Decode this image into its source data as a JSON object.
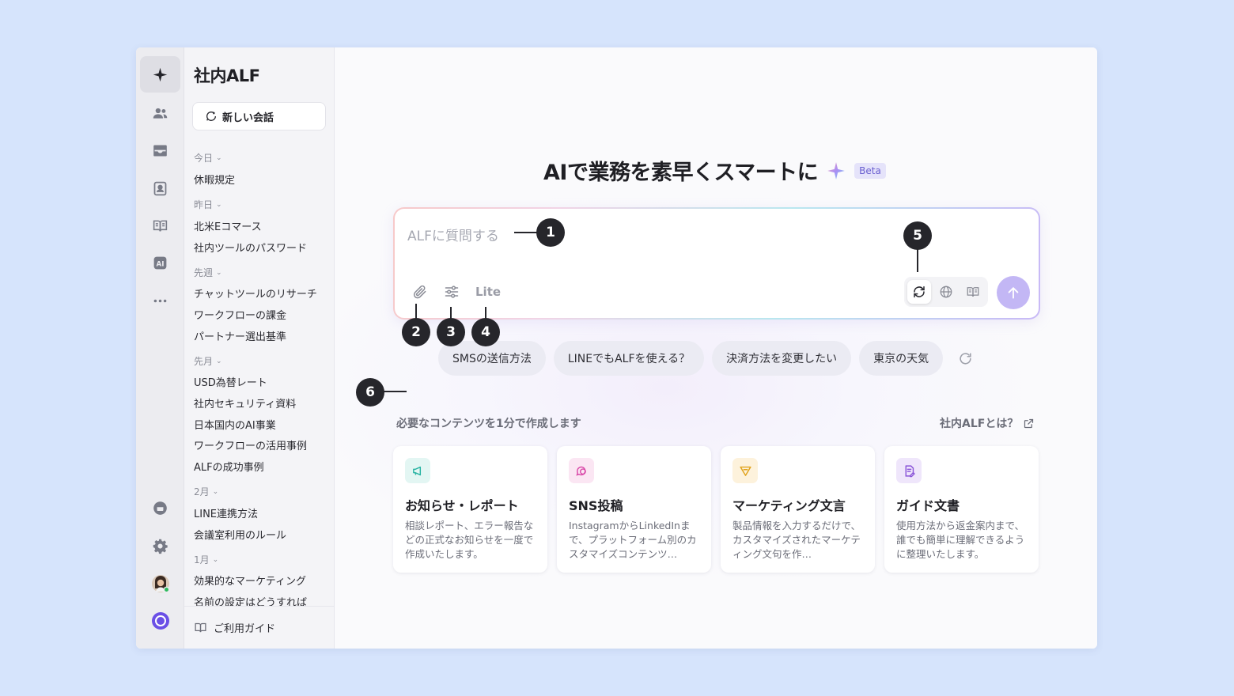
{
  "colors": {
    "background": "#d6e4fc",
    "accent": "#c3b7f5",
    "beta_bg": "#e5e3fa",
    "badge": "#26262b"
  },
  "rail": {
    "items": [
      {
        "icon": "sparkle-icon",
        "active": true
      },
      {
        "icon": "users-icon"
      },
      {
        "icon": "inbox-icon"
      },
      {
        "icon": "contact-card-icon"
      },
      {
        "icon": "book-icon"
      },
      {
        "icon": "ai-icon"
      },
      {
        "icon": "more-icon"
      }
    ],
    "bottom": [
      "chat-bubble-icon",
      "gear-icon",
      "avatar",
      "app-logo-icon"
    ]
  },
  "sidebar": {
    "title": "社内ALF",
    "new_chat_label": "新しい会話",
    "groups": [
      {
        "label": "今日",
        "items": [
          "休暇規定"
        ]
      },
      {
        "label": "昨日",
        "items": [
          "北米Eコマース",
          "社内ツールのパスワード"
        ]
      },
      {
        "label": "先週",
        "items": [
          "チャットツールのリサーチ",
          "ワークフローの課金",
          "パートナー選出基準"
        ]
      },
      {
        "label": "先月",
        "items": [
          "USD為替レート",
          "社内セキュリティ資料",
          "日本国内のAI事業",
          "ワークフローの活用事例",
          "ALFの成功事例"
        ]
      },
      {
        "label": "2月",
        "items": [
          "LINE連携方法",
          "会議室利用のルール"
        ]
      },
      {
        "label": "1月",
        "items": [
          "効果的なマーケティング",
          "名前の設定はどうすれば"
        ]
      }
    ],
    "guide_label": "ご利用ガイド"
  },
  "main": {
    "hero_title": "AIで業務を素早くスマートに",
    "beta_label": "Beta",
    "composer": {
      "placeholder": "ALFに質問する",
      "mode_label": "Lite"
    },
    "suggestions": [
      "SMSの送信方法",
      "LINEでもALFを使える？",
      "決済方法を変更したい",
      "東京の天気"
    ],
    "section_title": "必要なコンテンツを1分で作成します",
    "about_link": "社内ALFとは？",
    "cards": [
      {
        "title": "お知らせ・レポート",
        "desc": "相談レポート、エラー報告などの正式なお知らせを一度で作成いたします。",
        "icon": "megaphone-icon",
        "color": "#27b3a2",
        "bg": "#e3f6f3"
      },
      {
        "title": "SNS投稿",
        "desc": "InstagramからLinkedInまで、プラットフォーム別のカスタマイズコンテンツ…",
        "icon": "chat-bubbles-icon",
        "color": "#d948a8",
        "bg": "#fbe6f3"
      },
      {
        "title": "マーケティング文言",
        "desc": "製品情報を入力するだけで、カスタマイズされたマーケティング文句を作…",
        "icon": "pen-tool-icon",
        "color": "#e0a21a",
        "bg": "#fdf2dc"
      },
      {
        "title": "ガイド文書",
        "desc": "使用方法から返金案内まで、誰でも簡単に理解できるように整理いたします。",
        "icon": "document-icon",
        "color": "#8a55d8",
        "bg": "#efe6fb"
      }
    ]
  },
  "annotations": [
    "1",
    "2",
    "3",
    "4",
    "5",
    "6"
  ]
}
